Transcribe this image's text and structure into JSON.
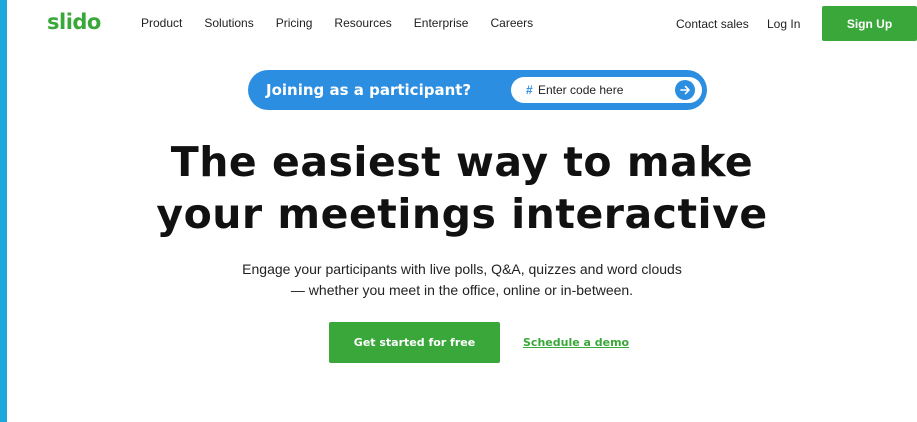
{
  "header": {
    "logo": "slido",
    "nav": [
      "Product",
      "Solutions",
      "Pricing",
      "Resources",
      "Enterprise",
      "Careers"
    ],
    "contact_sales": "Contact sales",
    "login": "Log In",
    "signup": "Sign Up"
  },
  "participant": {
    "label": "Joining as a participant?",
    "hash": "#",
    "placeholder": "Enter code here",
    "go_icon": "arrow-right-icon"
  },
  "hero": {
    "headline_line1": "The easiest way to make",
    "headline_line2": "your meetings interactive",
    "sub_line1": "Engage your participants with live polls, Q&A, quizzes and word clouds",
    "sub_line2": "— whether you meet in the office, online or in-between.",
    "cta": "Get started for free",
    "demo": "Schedule a demo"
  },
  "colors": {
    "brand_green": "#3aa73a",
    "pill_blue": "#2c8ee0",
    "frame_blue": "#1ba8dc"
  }
}
